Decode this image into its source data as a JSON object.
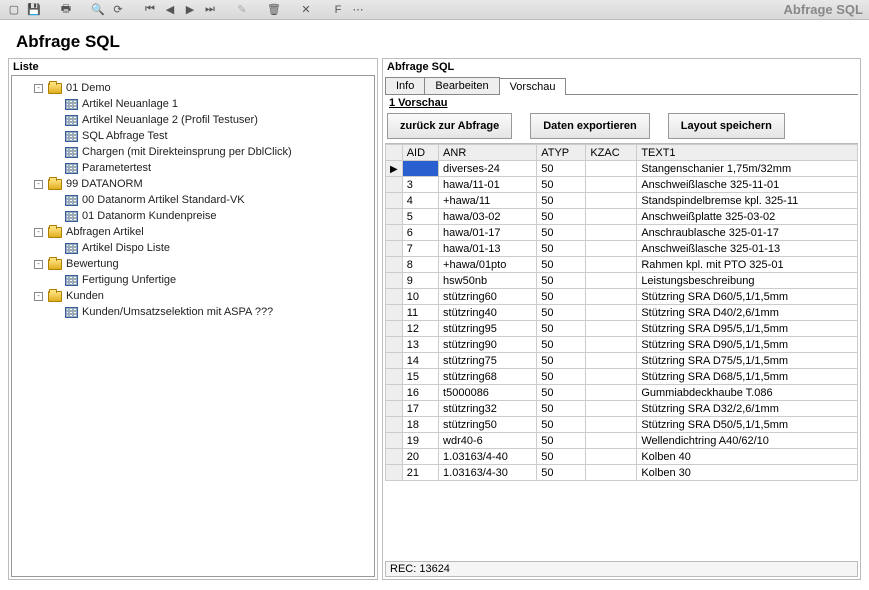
{
  "app_title": "Abfrage SQL",
  "page_title": "Abfrage SQL",
  "left_panel_title": "Liste",
  "right_panel_title": "Abfrage SQL",
  "tabs": [
    "Info",
    "Bearbeiten",
    "Vorschau"
  ],
  "active_tab": 2,
  "preview_header": "1 Vorschau",
  "buttons": {
    "back": "zurück zur Abfrage",
    "export": "Daten exportieren",
    "save_layout": "Layout speichern"
  },
  "tree": [
    {
      "t": "folder",
      "l": "01 Demo",
      "exp": "-",
      "d": 0
    },
    {
      "t": "item",
      "l": "Artikel Neuanlage 1",
      "d": 1
    },
    {
      "t": "item",
      "l": "Artikel Neuanlage 2 (Profil Testuser)",
      "d": 1
    },
    {
      "t": "item",
      "l": "SQL Abfrage Test",
      "d": 1
    },
    {
      "t": "item",
      "l": "Chargen (mit Direkteinsprung per DblClick)",
      "d": 1
    },
    {
      "t": "item",
      "l": "Parametertest",
      "d": 1
    },
    {
      "t": "folder",
      "l": "99 DATANORM",
      "exp": "-",
      "d": 0
    },
    {
      "t": "item",
      "l": "00 Datanorm Artikel Standard-VK",
      "d": 1
    },
    {
      "t": "item",
      "l": "01 Datanorm Kundenpreise",
      "d": 1
    },
    {
      "t": "folder",
      "l": "Abfragen Artikel",
      "exp": "-",
      "d": 0
    },
    {
      "t": "item",
      "l": "Artikel Dispo Liste",
      "d": 1
    },
    {
      "t": "folder",
      "l": "Bewertung",
      "exp": "-",
      "d": 0
    },
    {
      "t": "item",
      "l": "Fertigung Unfertige",
      "d": 1
    },
    {
      "t": "folder",
      "l": "Kunden",
      "exp": "-",
      "d": 0
    },
    {
      "t": "item",
      "l": "Kunden/Umsatzselektion mit ASPA ???",
      "d": 1
    }
  ],
  "columns": [
    "AID",
    "ANR",
    "ATYP",
    "KZAC",
    "TEXT1"
  ],
  "sorted_col": "TEXT1",
  "rows": [
    {
      "sel": true,
      "aid": "",
      "anr": "diverses-24",
      "atyp": 50,
      "kzac": "",
      "text1": "Stangenschanier 1,75m/32mm"
    },
    {
      "aid": 3,
      "anr": "hawa/11-01",
      "atyp": 50,
      "kzac": "",
      "text1": "Anschweißlasche     325-11-01"
    },
    {
      "aid": 4,
      "anr": "+hawa/11",
      "atyp": 50,
      "kzac": "",
      "text1": "Standspindelbremse kpl. 325-11"
    },
    {
      "aid": 5,
      "anr": "hawa/03-02",
      "atyp": 50,
      "kzac": "",
      "text1": "Anschweißplatte     325-03-02"
    },
    {
      "aid": 6,
      "anr": "hawa/01-17",
      "atyp": 50,
      "kzac": "",
      "text1": "Anschraublasche     325-01-17"
    },
    {
      "aid": 7,
      "anr": "hawa/01-13",
      "atyp": 50,
      "kzac": "",
      "text1": "Anschweißlasche     325-01-13"
    },
    {
      "aid": 8,
      "anr": "+hawa/01pto",
      "atyp": 50,
      "kzac": "",
      "text1": "Rahmen kpl. mit PTO     325-01"
    },
    {
      "aid": 9,
      "anr": "hsw50nb",
      "atyp": 50,
      "kzac": "",
      "text1": "Leistungsbeschreibung"
    },
    {
      "aid": 10,
      "anr": "stützring60",
      "atyp": 50,
      "kzac": "",
      "text1": "Stützring SRA D60/5,1/1,5mm"
    },
    {
      "aid": 11,
      "anr": "stützring40",
      "atyp": 50,
      "kzac": "",
      "text1": "Stützring SRA D40/2,6/1mm"
    },
    {
      "aid": 12,
      "anr": "stützring95",
      "atyp": 50,
      "kzac": "",
      "text1": "Stützring SRA D95/5,1/1,5mm"
    },
    {
      "aid": 13,
      "anr": "stützring90",
      "atyp": 50,
      "kzac": "",
      "text1": "Stützring SRA D90/5,1/1,5mm"
    },
    {
      "aid": 14,
      "anr": "stützring75",
      "atyp": 50,
      "kzac": "",
      "text1": "Stützring SRA D75/5,1/1,5mm"
    },
    {
      "aid": 15,
      "anr": "stützring68",
      "atyp": 50,
      "kzac": "",
      "text1": "Stützring SRA D68/5,1/1,5mm"
    },
    {
      "aid": 16,
      "anr": "t5000086",
      "atyp": 50,
      "kzac": "",
      "text1": "Gummiabdeckhaube        T.086"
    },
    {
      "aid": 17,
      "anr": "stützring32",
      "atyp": 50,
      "kzac": "",
      "text1": "Stützring SRA D32/2,6/1mm"
    },
    {
      "aid": 18,
      "anr": "stützring50",
      "atyp": 50,
      "kzac": "",
      "text1": "Stützring SRA D50/5,1/1,5mm"
    },
    {
      "aid": 19,
      "anr": "wdr40-6",
      "atyp": 50,
      "kzac": "",
      "text1": "Wellendichtring A40/62/10"
    },
    {
      "aid": 20,
      "anr": "1.03163/4-40",
      "atyp": 50,
      "kzac": "",
      "text1": "Kolben 40"
    },
    {
      "aid": 21,
      "anr": "1.03163/4-30",
      "atyp": 50,
      "kzac": "",
      "text1": "Kolben 30"
    }
  ],
  "status": "REC: 13624"
}
